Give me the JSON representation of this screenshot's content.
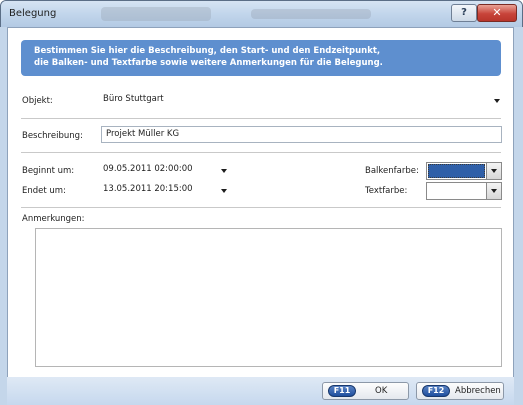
{
  "window": {
    "title": "Belegung",
    "help_label": "?",
    "close_label": "✕"
  },
  "banner": {
    "line1": "Bestimmen Sie hier die Beschreibung, den Start- und den Endzeitpunkt,",
    "line2": "die Balken- und Textfarbe sowie weitere Anmerkungen für die Belegung."
  },
  "form": {
    "objekt_label": "Objekt:",
    "objekt_value": "Büro Stuttgart",
    "beschreibung_label": "Beschreibung:",
    "beschreibung_value": "Projekt Müller KG",
    "beginnt_label": "Beginnt um:",
    "beginnt_value": "09.05.2011 02:00:00",
    "endet_label": "Endet um:",
    "endet_value": "13.05.2011 20:15:00",
    "balkenfarbe_label": "Balkenfarbe:",
    "balkenfarbe_color": "#2f5fa8",
    "textfarbe_label": "Textfarbe:",
    "textfarbe_color": "#ffffff",
    "anmerkungen_label": "Anmerkungen:",
    "anmerkungen_value": ""
  },
  "buttons": {
    "ok_key": "F11",
    "ok_label": "OK",
    "cancel_key": "F12",
    "cancel_label": "Abbrechen"
  },
  "colors": {
    "banner_bg": "#5e8fcf",
    "window_frame": "#b9cde3",
    "key_badge": "#2a5bab"
  }
}
